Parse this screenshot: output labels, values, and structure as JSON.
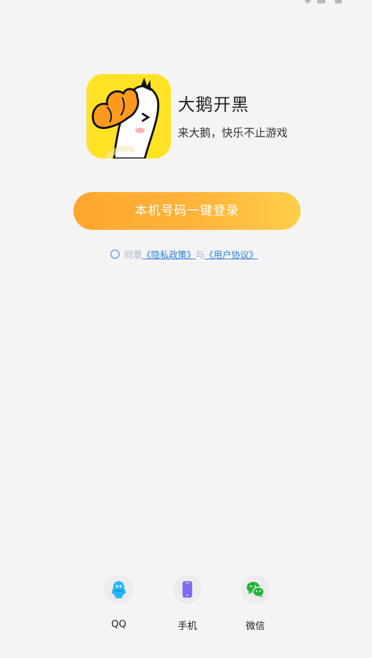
{
  "app": {
    "title": "大鹅开黑",
    "subtitle": "来大鹅，快乐不止游戏"
  },
  "login": {
    "one_click_label": "本机号码一键登录"
  },
  "agreement": {
    "prefix": "同意",
    "privacy_link": "《隐私政策》",
    "joiner": "与",
    "terms_link": "《用户协议》"
  },
  "social_login": {
    "qq_label": "QQ",
    "phone_label": "手机",
    "wechat_label": "微信"
  },
  "colors": {
    "accent_orange": "#ffa62e",
    "link_blue": "#2a7fd6",
    "logo_yellow": "#ffe324"
  }
}
